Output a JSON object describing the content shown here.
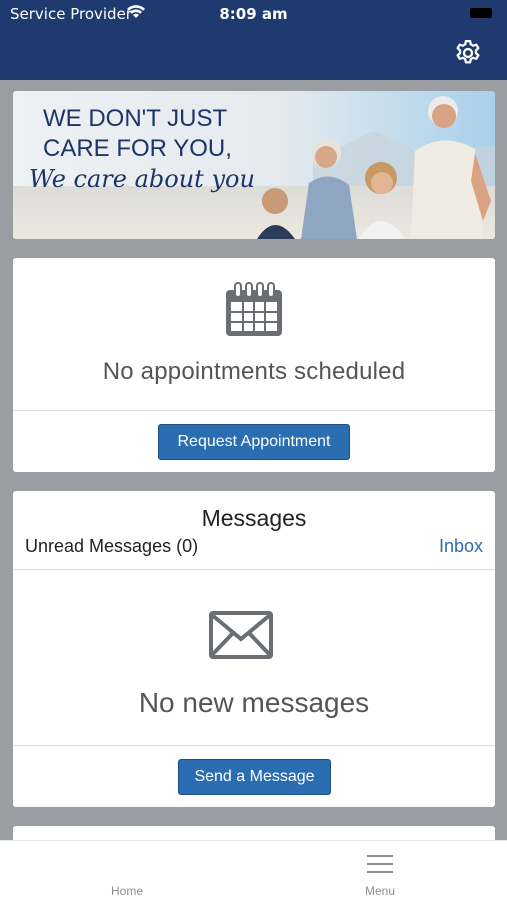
{
  "status": {
    "carrier": "Service Provider",
    "time": "8:09 am"
  },
  "banner": {
    "line1": "WE DON'T JUST",
    "line2": "CARE FOR YOU,",
    "line3": "We care about you"
  },
  "appointments": {
    "empty_text": "No appointments scheduled",
    "button_label": "Request Appointment"
  },
  "messages": {
    "title": "Messages",
    "unread_label": "Unread Messages (0)",
    "inbox_link": "Inbox",
    "empty_text": "No new messages",
    "button_label": "Send a Message"
  },
  "tabbar": {
    "home_label": "Home",
    "menu_label": "Menu"
  },
  "icons": {
    "settings": "gear-icon",
    "calendar": "calendar-icon",
    "envelope": "envelope-icon",
    "menu": "hamburger-icon"
  },
  "colors": {
    "header": "#1e3a6e",
    "accent": "#2a6db0",
    "background": "#9a9ea3"
  }
}
